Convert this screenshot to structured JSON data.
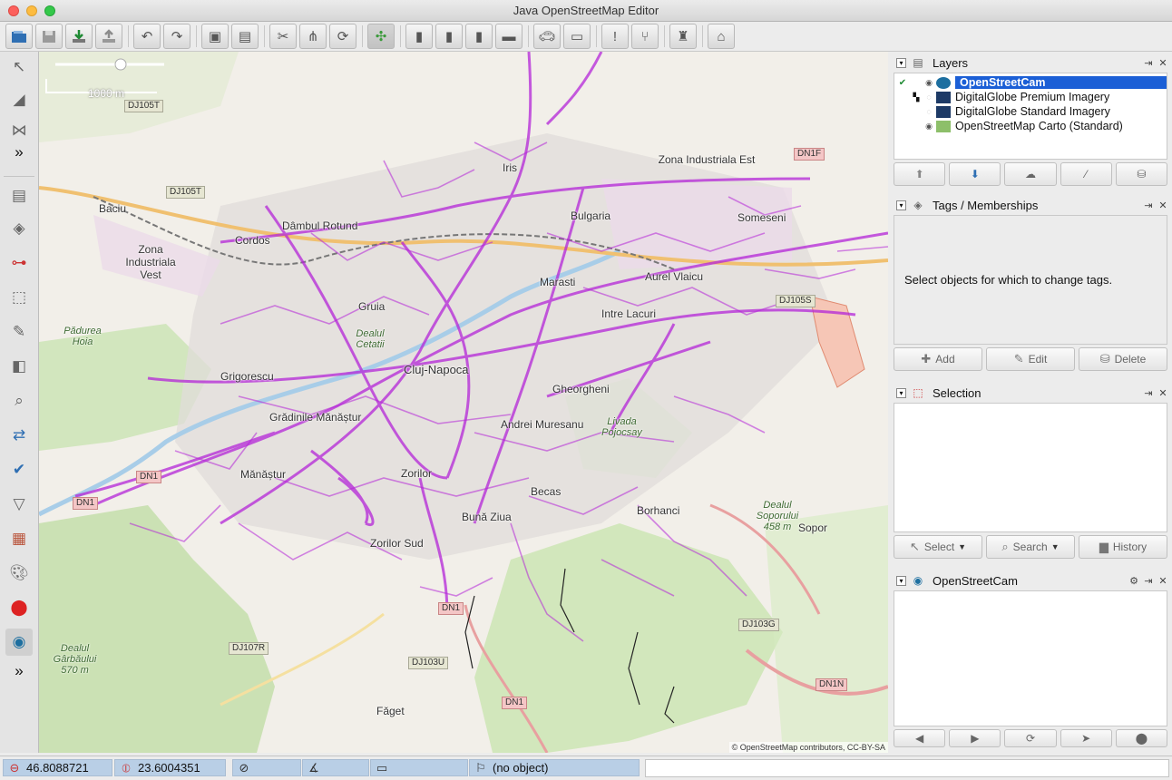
{
  "window": {
    "title": "Java OpenStreetMap Editor"
  },
  "toolbar": {
    "icons": [
      "open-file-icon",
      "save-icon",
      "download-icon",
      "upload-icon",
      "undo-icon",
      "redo-icon",
      "preferences-icon",
      "layers-icon",
      "split-icon",
      "combine-icon",
      "refresh-icon",
      "validate-icon",
      "building-1-icon",
      "building-2-icon",
      "building-3-icon",
      "building-4-icon",
      "car-icon",
      "bus-icon",
      "warning-icon",
      "restaurant-icon",
      "castle-icon",
      "industrial-icon"
    ]
  },
  "map": {
    "scale_label": "1000 m",
    "attribution": "© OpenStreetMap contributors, CC-BY-SA",
    "places": [
      {
        "name": "Baciu"
      },
      {
        "name": "Zona Industriala Vest"
      },
      {
        "name": "Cordos"
      },
      {
        "name": "Dâmbul Rotund"
      },
      {
        "name": "Iris"
      },
      {
        "name": "Bulgaria"
      },
      {
        "name": "Zona Industriala Est"
      },
      {
        "name": "Someseni"
      },
      {
        "name": "Marasti"
      },
      {
        "name": "Aurel Vlaicu"
      },
      {
        "name": "Gruia"
      },
      {
        "name": "Intre Lacuri"
      },
      {
        "name": "Dealul Cetatii"
      },
      {
        "name": "Grigorescu"
      },
      {
        "name": "Cluj-Napoca"
      },
      {
        "name": "Gheorgheni"
      },
      {
        "name": "Grădinile Mănăștur"
      },
      {
        "name": "Andrei Muresanu"
      },
      {
        "name": "Mănăștur"
      },
      {
        "name": "Zorilor"
      },
      {
        "name": "Becas"
      },
      {
        "name": "Borhanci"
      },
      {
        "name": "Bună Ziua"
      },
      {
        "name": "Zorilor Sud"
      },
      {
        "name": "Sopor"
      },
      {
        "name": "Dealul Soporului 458 m"
      },
      {
        "name": "Fǎget"
      },
      {
        "name": "Pădurea Hoia"
      },
      {
        "name": "Livada Pojocsay"
      },
      {
        "name": "Dealul Gârbăului 570 m"
      }
    ],
    "roads": [
      "DJ105T",
      "DJ105T",
      "DN1F",
      "DJ105S",
      "DN1",
      "DN1",
      "DN1",
      "DJ107R",
      "DJ103U",
      "DJ103G",
      "DN1N",
      "DN1"
    ]
  },
  "layers_panel": {
    "title": "Layers",
    "layers": [
      {
        "name": "OpenStreetCam",
        "selected": true,
        "active": true,
        "visible": true
      },
      {
        "name": "DigitalGlobe Premium Imagery",
        "selected": false,
        "active": false,
        "visible": false
      },
      {
        "name": "DigitalGlobe Standard Imagery",
        "selected": false,
        "active": false,
        "visible": false
      },
      {
        "name": "OpenStreetMap Carto (Standard)",
        "selected": false,
        "active": false,
        "visible": true
      }
    ],
    "buttons": [
      "move-up-icon",
      "move-down-icon",
      "merge-icon",
      "duplicate-icon",
      "delete-layer-icon"
    ]
  },
  "tags_panel": {
    "title": "Tags / Memberships",
    "empty_message": "Select objects for which to change tags.",
    "add_label": "Add",
    "edit_label": "Edit",
    "delete_label": "Delete"
  },
  "selection_panel": {
    "title": "Selection",
    "select_label": "Select",
    "search_label": "Search",
    "history_label": "History"
  },
  "openstreetcam_panel": {
    "title": "OpenStreetCam"
  },
  "statusbar": {
    "latitude": "46.8088721",
    "longitude": "23.6004351",
    "heading": "",
    "angle": "",
    "distance": "",
    "object": "(no object)"
  },
  "colors": {
    "selection_blue": "#1b5fd6",
    "coverage_purple": "#b425d8",
    "status_blue": "#b9cfe6"
  }
}
